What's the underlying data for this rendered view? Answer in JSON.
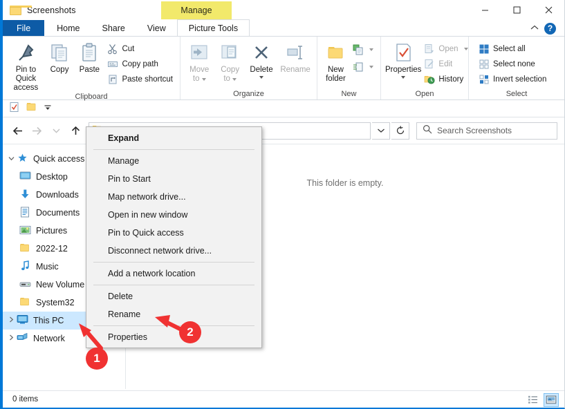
{
  "window": {
    "title": "Screenshots",
    "contextual_tab_header": "Manage",
    "minimize_label": "Minimize",
    "maximize_label": "Maximize",
    "close_label": "Close",
    "collapse_ribbon_label": "Collapse the Ribbon",
    "help_label": "?"
  },
  "tabs": [
    {
      "label": "File"
    },
    {
      "label": "Home"
    },
    {
      "label": "Share"
    },
    {
      "label": "View"
    },
    {
      "label": "Picture Tools"
    }
  ],
  "ribbon": {
    "groups": [
      {
        "label": "Clipboard",
        "big_buttons": [
          {
            "label_line1": "Pin to Quick",
            "label_line2": "access",
            "icon": "pin-icon",
            "disabled": false
          },
          {
            "label_line1": "Copy",
            "label_line2": "",
            "icon": "copy-icon",
            "disabled": false
          },
          {
            "label_line1": "Paste",
            "label_line2": "",
            "icon": "paste-icon",
            "disabled": false
          }
        ],
        "small_buttons": [
          {
            "label": "Cut",
            "icon": "scissors-icon",
            "disabled": false
          },
          {
            "label": "Copy path",
            "icon": "copy-path-icon",
            "disabled": false
          },
          {
            "label": "Paste shortcut",
            "icon": "paste-shortcut-icon",
            "disabled": false
          }
        ]
      },
      {
        "label": "Organize",
        "big_buttons": [
          {
            "label_line1": "Move",
            "label_line2": "to",
            "icon": "move-to-icon",
            "disabled": true,
            "has_caret": true
          },
          {
            "label_line1": "Copy",
            "label_line2": "to",
            "icon": "copy-to-icon",
            "disabled": true,
            "has_caret": true
          },
          {
            "label_line1": "Delete",
            "label_line2": "",
            "icon": "delete-x-icon",
            "disabled": false,
            "has_caret": true
          },
          {
            "label_line1": "Rename",
            "label_line2": "",
            "icon": "rename-icon",
            "disabled": true
          }
        ]
      },
      {
        "label": "New",
        "big_buttons": [
          {
            "label_line1": "New",
            "label_line2": "folder",
            "icon": "new-folder-icon",
            "disabled": false
          }
        ],
        "small_buttons": [
          {
            "label": "",
            "icon": "new-item-icon",
            "has_caret": true
          },
          {
            "label": "",
            "icon": "easy-access-icon",
            "has_caret": true
          }
        ]
      },
      {
        "label": "Open",
        "big_buttons": [
          {
            "label_line1": "Properties",
            "label_line2": "",
            "icon": "properties-icon",
            "disabled": false,
            "has_caret": true
          }
        ],
        "small_buttons": [
          {
            "label": "Open",
            "icon": "open-icon",
            "disabled": true,
            "has_caret": true
          },
          {
            "label": "Edit",
            "icon": "edit-icon",
            "disabled": true
          },
          {
            "label": "History",
            "icon": "history-icon",
            "disabled": false
          }
        ]
      },
      {
        "label": "Select",
        "small_buttons": [
          {
            "label": "Select all",
            "icon": "select-all-icon",
            "disabled": false
          },
          {
            "label": "Select none",
            "icon": "select-none-icon",
            "disabled": false
          },
          {
            "label": "Invert selection",
            "icon": "invert-selection-icon",
            "disabled": false
          }
        ]
      }
    ]
  },
  "quick_access_toolbar": [
    {
      "icon": "properties-qat-icon",
      "label": "Properties"
    },
    {
      "icon": "new-folder-qat-icon",
      "label": "New folder"
    },
    {
      "icon": "customize-qat-icon",
      "label": "Customize Quick Access Toolbar"
    }
  ],
  "navigation": {
    "back_label": "Back",
    "forward_label": "Forward",
    "recent_label": "Recent locations",
    "up_label": "Up",
    "refresh_label": "Refresh",
    "path_dropdown_label": "Previous locations"
  },
  "search": {
    "placeholder": "Search Screenshots"
  },
  "sidebar": {
    "items": [
      {
        "label": "Quick access",
        "icon": "star-pin-icon",
        "chevron": "expanded",
        "indent": 0,
        "selected": false
      },
      {
        "label": "Desktop",
        "icon": "desktop-icon",
        "chevron": "none",
        "indent": 1,
        "selected": false
      },
      {
        "label": "Downloads",
        "icon": "downloads-icon",
        "chevron": "none",
        "indent": 1,
        "selected": false
      },
      {
        "label": "Documents",
        "icon": "documents-icon",
        "chevron": "none",
        "indent": 1,
        "selected": false
      },
      {
        "label": "Pictures",
        "icon": "pictures-icon",
        "chevron": "none",
        "indent": 1,
        "selected": false
      },
      {
        "label": "2022-12",
        "icon": "folder-icon",
        "chevron": "none",
        "indent": 1,
        "selected": false
      },
      {
        "label": "Music",
        "icon": "music-icon",
        "chevron": "none",
        "indent": 1,
        "selected": false
      },
      {
        "label": "New Volume",
        "icon": "drive-icon",
        "chevron": "none",
        "indent": 1,
        "selected": false
      },
      {
        "label": "System32",
        "icon": "folder-icon",
        "chevron": "none",
        "indent": 1,
        "selected": false
      },
      {
        "label": "This PC",
        "icon": "this-pc-icon",
        "chevron": "collapsed",
        "indent": 0,
        "selected": true
      },
      {
        "label": "Network",
        "icon": "network-icon",
        "chevron": "collapsed",
        "indent": 0,
        "selected": false
      }
    ]
  },
  "main": {
    "empty_message": "This folder is empty."
  },
  "context_menu": [
    {
      "label": "Expand",
      "bold": true,
      "separator_after": true
    },
    {
      "label": "Manage",
      "bold": false,
      "separator_after": false
    },
    {
      "label": "Pin to Start",
      "bold": false,
      "separator_after": false
    },
    {
      "label": "Map network drive...",
      "bold": false,
      "separator_after": false
    },
    {
      "label": "Open in new window",
      "bold": false,
      "separator_after": false
    },
    {
      "label": "Pin to Quick access",
      "bold": false,
      "separator_after": false
    },
    {
      "label": "Disconnect network drive...",
      "bold": false,
      "separator_after": true
    },
    {
      "label": "Add a network location",
      "bold": false,
      "separator_after": true
    },
    {
      "label": "Delete",
      "bold": false,
      "separator_after": false
    },
    {
      "label": "Rename",
      "bold": false,
      "separator_after": true
    },
    {
      "label": "Properties",
      "bold": false,
      "separator_after": false
    }
  ],
  "status_bar": {
    "item_count": "0 items",
    "view_details_label": "Details view",
    "view_large_icons_label": "Large icons view"
  },
  "annotations": [
    {
      "number": "1",
      "target": "This PC"
    },
    {
      "number": "2",
      "target": "Properties"
    }
  ],
  "colors": {
    "accent": "#0078d7",
    "file_tab": "#0d5ba6",
    "contextual_tab": "#f2e96b",
    "selection": "#cce8ff",
    "annotation_red": "#f03232",
    "menu_bg": "#f2f2f2"
  }
}
